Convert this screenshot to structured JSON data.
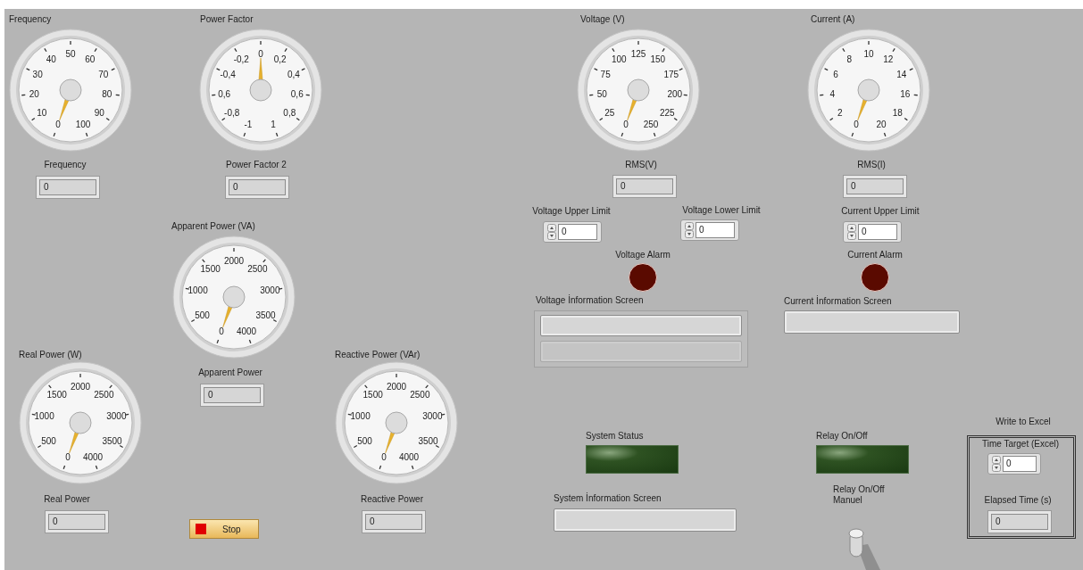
{
  "gauges": [
    {
      "title": "Frequency",
      "scale": [
        "0",
        "10",
        "20",
        "30",
        "40",
        "50",
        "60",
        "70",
        "80",
        "90",
        "100"
      ]
    },
    {
      "title": "Power Factor",
      "scale": [
        "-1",
        "-0,8",
        "0,6",
        "-0,4",
        "-0,2",
        "0",
        "0,2",
        "0,4",
        "0,6",
        "0,8",
        "1"
      ]
    },
    {
      "title": "Voltage (V)",
      "scale": [
        "0",
        "25",
        "50",
        "75",
        "100",
        "125",
        "150",
        "175",
        "200",
        "225",
        "250"
      ]
    },
    {
      "title": "Current (A)",
      "scale": [
        "0",
        "2",
        "4",
        "6",
        "8",
        "10",
        "12",
        "14",
        "16",
        "18",
        "20"
      ]
    },
    {
      "title": "Apparent Power (VA)",
      "scale": [
        "0",
        "500",
        "1000",
        "1500",
        "2000",
        "2500",
        "3000",
        "3500",
        "4000"
      ]
    },
    {
      "title": "Real Power (W)",
      "scale": [
        "0",
        "500",
        "1000",
        "1500",
        "2000",
        "2500",
        "3000",
        "3500",
        "4000"
      ]
    },
    {
      "title": "Reactive Power (VAr)",
      "scale": [
        "0",
        "500",
        "1000",
        "1500",
        "2000",
        "2500",
        "3000",
        "3500",
        "4000"
      ]
    }
  ],
  "indicators": [
    {
      "label": "Frequency",
      "value": "0"
    },
    {
      "label": "Power Factor 2",
      "value": "0"
    },
    {
      "label": "RMS(V)",
      "value": "0"
    },
    {
      "label": "RMS(I)",
      "value": "0"
    },
    {
      "label": "Apparent Power",
      "value": "0"
    },
    {
      "label": "Real Power",
      "value": "0"
    },
    {
      "label": "Reactive Power",
      "value": "0"
    }
  ],
  "controls": [
    {
      "label": "Voltage Upper Limit",
      "value": "0"
    },
    {
      "label": "Voltage Lower Limit",
      "value": "0"
    },
    {
      "label": "Current Upper Limit",
      "value": "0"
    }
  ],
  "alarms": [
    {
      "label": "Voltage Alarm",
      "on": false
    },
    {
      "label": "Current Alarm",
      "on": false
    }
  ],
  "status_lights": [
    {
      "label": "System Status",
      "on": false
    },
    {
      "label": "Relay On/Off",
      "on": false
    }
  ],
  "info_screens": [
    {
      "label": "Voltage İnformation Screen",
      "kind": "cluster"
    },
    {
      "label": "Current İnformation Screen",
      "kind": "string"
    },
    {
      "label": "System İnformation Screen",
      "kind": "string"
    }
  ],
  "relay_switch": {
    "label": "Relay On/Off Manuel",
    "on": false
  },
  "stop_button": {
    "label": "Stop"
  },
  "excel": {
    "title": "Write to Excel",
    "time_target": {
      "label": "Time Target (Excel)",
      "value": "0"
    },
    "elapsed": {
      "label": "Elapsed Time (s)",
      "value": "0"
    }
  }
}
